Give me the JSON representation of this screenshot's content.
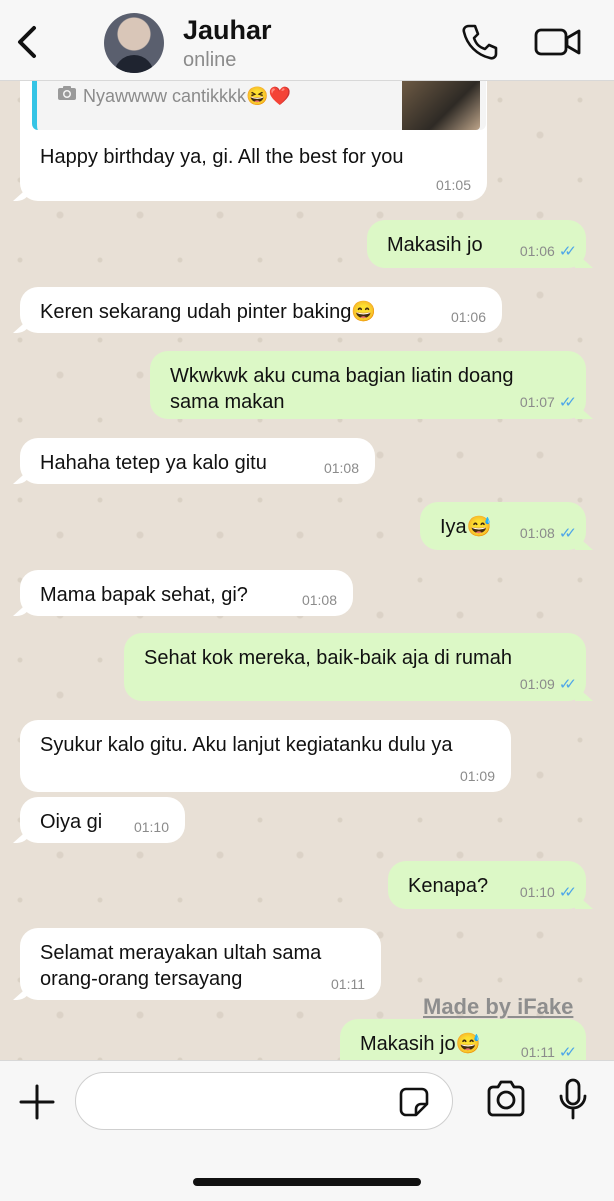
{
  "header": {
    "contact_name": "Jauhar",
    "status": "online"
  },
  "reply_preview": {
    "text": "Nyawwww cantikkkk😆❤️"
  },
  "messages": [
    {
      "dir": "in",
      "text": "Happy birthday ya, gi. All the best for you",
      "time": "01:05"
    },
    {
      "dir": "out",
      "text": "Makasih jo",
      "time": "01:06"
    },
    {
      "dir": "in",
      "text": "Keren sekarang udah pinter baking😄",
      "time": "01:06"
    },
    {
      "dir": "out",
      "text": "Wkwkwk aku cuma bagian liatin doang sama makan",
      "time": "01:07"
    },
    {
      "dir": "in",
      "text": "Hahaha tetep ya kalo gitu",
      "time": "01:08"
    },
    {
      "dir": "out",
      "text": "Iya😅",
      "time": "01:08"
    },
    {
      "dir": "in",
      "text": "Mama bapak sehat, gi?",
      "time": "01:08"
    },
    {
      "dir": "out",
      "text": "Sehat kok mereka, baik-baik aja di rumah",
      "time": "01:09"
    },
    {
      "dir": "in",
      "text": "Syukur kalo gitu. Aku lanjut kegiatanku dulu ya",
      "time": "01:09"
    },
    {
      "dir": "in",
      "text": "Oiya gi",
      "time": "01:10"
    },
    {
      "dir": "out",
      "text": "Kenapa?",
      "time": "01:10"
    },
    {
      "dir": "in",
      "text": "Selamat merayakan ultah sama orang-orang tersayang",
      "time": "01:11"
    },
    {
      "dir": "out",
      "text": "Makasih jo😅",
      "time": "01:11"
    }
  ],
  "watermark": "Made by iFake",
  "read_ticks": "✓✓",
  "colors": {
    "outgoing_bubble": "#dcf8c6",
    "incoming_bubble": "#ffffff",
    "read_receipt": "#4fa6e8",
    "reply_accent": "#35c4e5"
  },
  "icons": [
    "back-chevron-icon",
    "phone-icon",
    "video-camera-icon",
    "camera-icon",
    "plus-icon",
    "sticker-icon",
    "mic-icon"
  ]
}
